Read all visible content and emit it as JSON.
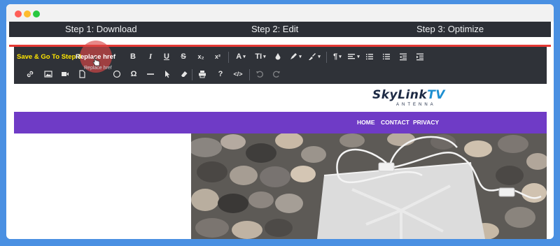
{
  "window": {
    "controls": [
      "close",
      "minimize",
      "maximize"
    ]
  },
  "steps": {
    "step1": "Step 1: Download",
    "step2": "Step 2: Edit",
    "step3": "Step 3: Optimize"
  },
  "toolbar": {
    "save_label": "Save & Go To Step 3",
    "replace_label": "Replace href",
    "replace_tooltip": "Replace href",
    "bold": "B",
    "italic": "I",
    "underline": "U",
    "strike": "S",
    "subscript": "x₂",
    "superscript": "x²",
    "font_family": "A",
    "font_size": "TI",
    "paragraph": "¶",
    "special_chars": "Ω",
    "help": "?",
    "code": "</>",
    "icons": [
      "link-icon",
      "image-icon",
      "video-icon",
      "file-icon",
      "emoticon-icon",
      "special-characters-icon",
      "horizontal-line-icon",
      "select-all-icon",
      "clear-formatting-icon",
      "print-icon",
      "help-icon",
      "code-view-icon",
      "undo-icon",
      "redo-icon",
      "text-color-icon",
      "highlight-color-icon",
      "inline-style-icon",
      "align-icon",
      "ordered-list-icon",
      "unordered-list-icon",
      "outdent-icon",
      "indent-icon"
    ]
  },
  "site": {
    "logo_main": "SkyLink",
    "logo_tv": "TV",
    "logo_sub": "ANTENNA",
    "nav": [
      "HOME",
      "CONTACT",
      "PRIVACY"
    ]
  },
  "colors": {
    "nav_bg": "#6f3bc6",
    "toolbar_bg": "#2f3238",
    "save_label": "#ffe600",
    "accent_red": "#e53935"
  }
}
